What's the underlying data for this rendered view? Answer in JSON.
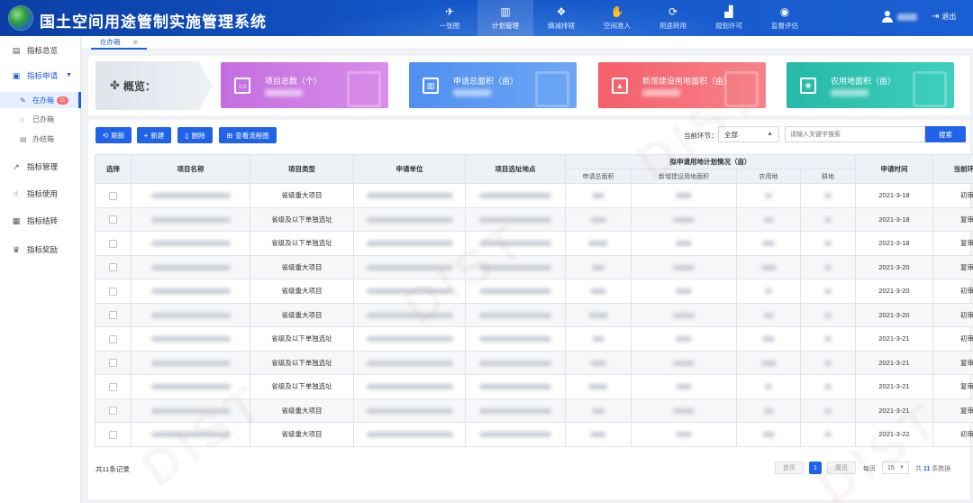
{
  "app": {
    "title": "国土空间用途管制实施管理系统"
  },
  "nav": [
    {
      "label": "一张图",
      "icon": "map-fly-icon",
      "glyph": "✈"
    },
    {
      "label": "计划管理",
      "icon": "bar-chart-icon",
      "glyph": "▥",
      "active": true
    },
    {
      "label": "熵减排辖",
      "icon": "puzzle-icon",
      "glyph": "❖"
    },
    {
      "label": "空间准入",
      "icon": "hand-icon",
      "glyph": "✋"
    },
    {
      "label": "用途转用",
      "icon": "refresh-icon",
      "glyph": "⟳"
    },
    {
      "label": "规划许可",
      "icon": "building-icon",
      "glyph": "▟"
    },
    {
      "label": "监督评估",
      "icon": "eye-icon",
      "glyph": "◉"
    }
  ],
  "header": {
    "logout_label": "退出"
  },
  "sidebar": {
    "items": [
      {
        "label": "指标总览",
        "glyph": "▤"
      },
      {
        "label": "指标申请",
        "glyph": "▣"
      },
      {
        "label": "指标管理",
        "glyph": "↗"
      },
      {
        "label": "指标使用",
        "glyph": "☝"
      },
      {
        "label": "指标结转",
        "glyph": "▦"
      },
      {
        "label": "指标奖励",
        "glyph": "♛"
      }
    ],
    "subitems": [
      {
        "label": "在办箱",
        "glyph": "✎",
        "badge": "11"
      },
      {
        "label": "已办箱",
        "glyph": "⌂"
      },
      {
        "label": "办结箱",
        "glyph": "▤"
      }
    ]
  },
  "tabs": {
    "current": "在办箱",
    "close": "⊗"
  },
  "overview": {
    "label": "概览：",
    "cards": [
      {
        "label": "项目总数（个）",
        "glyph": "▭"
      },
      {
        "label": "申请总面积（亩）",
        "glyph": "▥"
      },
      {
        "label": "新增建设用地面积（亩）",
        "glyph": "▲"
      },
      {
        "label": "农用地面积（亩）",
        "glyph": "❀"
      }
    ]
  },
  "toolbar": {
    "refresh": "刷新",
    "new": "新建",
    "delete": "删除",
    "flow": "查看流程图",
    "stage_label": "当前环节：",
    "stage_value": "全部",
    "search_placeholder": "请输入关键字搜索",
    "search_button": "搜索"
  },
  "table": {
    "headers": {
      "select": "选择",
      "name": "项目名称",
      "type": "项目类型",
      "unit": "申请单位",
      "location": "项目选址地点",
      "plan_group": "拟申请用地计划情况（亩）",
      "plan_total": "申请总面积",
      "plan_new": "新增建设用地面积",
      "plan_agri": "农用地",
      "plan_farm": "耕地",
      "time": "申请时间",
      "stage": "当前环节"
    },
    "rows": [
      {
        "type": "省级重大项目",
        "time": "2021-3-18",
        "stage": "初审"
      },
      {
        "type": "省级及以下单独选址",
        "time": "2021-3-18",
        "stage": "复审"
      },
      {
        "type": "省级及以下单独选址",
        "time": "2021-3-18",
        "stage": "复审"
      },
      {
        "type": "省级重大项目",
        "time": "2021-3-20",
        "stage": "复审"
      },
      {
        "type": "省级重大项目",
        "time": "2021-3-20",
        "stage": "初审"
      },
      {
        "type": "省级重大项目",
        "time": "2021-3-20",
        "stage": "初审"
      },
      {
        "type": "省级及以下单独选址",
        "time": "2021-3-21",
        "stage": "初审"
      },
      {
        "type": "省级及以下单独选址",
        "time": "2021-3-21",
        "stage": "复审"
      },
      {
        "type": "省级及以下单独选址",
        "time": "2021-3-21",
        "stage": "复审"
      },
      {
        "type": "省级重大项目",
        "time": "2021-3-21",
        "stage": "复审"
      },
      {
        "type": "省级重大项目",
        "time": "2021-3-22",
        "stage": "初审"
      }
    ]
  },
  "footer": {
    "total": "共11条记录",
    "first": "首页",
    "current_page": "1",
    "last": "尾页",
    "per_label": "每页",
    "per_value": "15",
    "total_pages_prefix": "共",
    "total_pages": "11",
    "total_pages_suffix": "条数据"
  },
  "watermark": "DIST"
}
